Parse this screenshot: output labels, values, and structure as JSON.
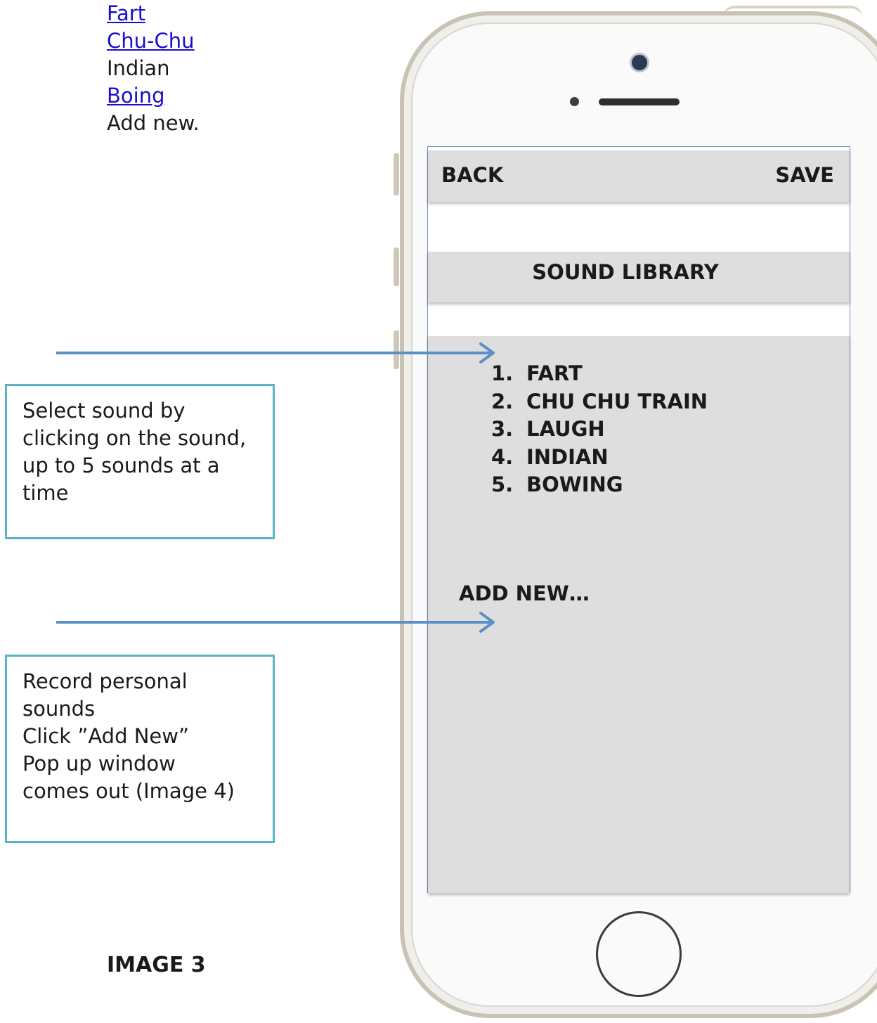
{
  "side_list": {
    "items": [
      {
        "label": "Fart",
        "link": true
      },
      {
        "label": "Chu-Chu",
        "link": true
      },
      {
        "label": "Indian",
        "link": false
      },
      {
        "label": "Boing",
        "link": true
      },
      {
        "label": "Add new.",
        "link": false
      }
    ]
  },
  "notes": {
    "select_sound": [
      "Select sound by",
      "clicking on the sound,",
      "up to 5 sounds at a",
      "time"
    ],
    "record_sound": [
      "Record personal",
      "sounds",
      "Click ”Add New”",
      "Pop up window",
      "comes out (Image 4)"
    ]
  },
  "image_label": "IMAGE 3",
  "screen": {
    "topbar": {
      "back_label": "BACK",
      "save_label": "SAVE"
    },
    "title": "SOUND LIBRARY",
    "sounds": [
      {
        "num": "1.",
        "label": "FART"
      },
      {
        "num": "2.",
        "label": "CHU CHU TRAIN"
      },
      {
        "num": "3.",
        "label": "LAUGH"
      },
      {
        "num": "4.",
        "label": "INDIAN"
      },
      {
        "num": "5.",
        "label": "BOWING"
      }
    ],
    "add_new_label": "ADD NEW…"
  },
  "colors": {
    "arrow": "#5b8fc7",
    "note_border": "#5ab4c6",
    "link": "#1a0dcc",
    "bar": "#dedede"
  }
}
